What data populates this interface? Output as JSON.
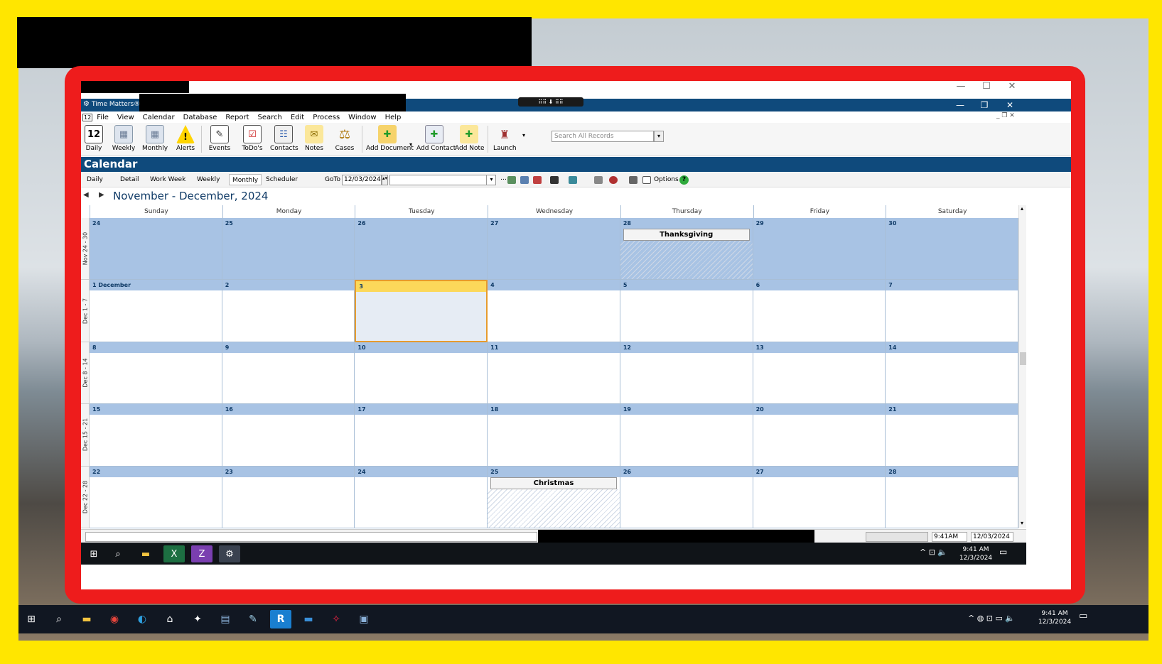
{
  "app": {
    "title": "Time Matters® -",
    "menus": [
      "File",
      "View",
      "Calendar",
      "Database",
      "Report",
      "Search",
      "Edit",
      "Process",
      "Window",
      "Help"
    ]
  },
  "toolbar": {
    "buttons": [
      {
        "label": "Daily",
        "icon": "calendar-day-icon",
        "glyph": "12"
      },
      {
        "label": "Weekly",
        "icon": "calendar-week-icon",
        "glyph": "▦"
      },
      {
        "label": "Monthly",
        "icon": "calendar-month-icon",
        "glyph": "▦"
      },
      {
        "label": "Alerts",
        "icon": "warning-icon",
        "glyph": "!"
      },
      {
        "label": "Events",
        "icon": "events-icon",
        "glyph": "✎"
      },
      {
        "label": "ToDo's",
        "icon": "todo-list-icon",
        "glyph": "☑"
      },
      {
        "label": "Contacts",
        "icon": "contacts-icon",
        "glyph": "☷"
      },
      {
        "label": "Notes",
        "icon": "notes-icon",
        "glyph": "✉"
      },
      {
        "label": "Cases",
        "icon": "scales-icon",
        "glyph": "⚖"
      },
      {
        "label": "Add Document",
        "icon": "add-document-icon",
        "glyph": "✚"
      },
      {
        "label": "Add Contact",
        "icon": "add-contact-icon",
        "glyph": "✚"
      },
      {
        "label": "Add Note",
        "icon": "add-note-icon",
        "glyph": "✚"
      },
      {
        "label": "Launch",
        "icon": "launch-bell-icon",
        "glyph": "♜"
      }
    ],
    "search_placeholder": "Search All Records"
  },
  "calendar": {
    "header": "Calendar",
    "views": [
      "Daily",
      "Detail",
      "Work Week",
      "Weekly",
      "Monthly",
      "Scheduler"
    ],
    "active_view": "Monthly",
    "goto_label": "GoTo",
    "goto_date": "12/03/2024",
    "options_label": "Options",
    "month_title": "November - December, 2024",
    "day_headers": [
      "Sunday",
      "Monday",
      "Tuesday",
      "Wednesday",
      "Thursday",
      "Friday",
      "Saturday"
    ],
    "weeks": [
      {
        "label": "Nov 24 - 30",
        "days": [
          "24",
          "25",
          "26",
          "27",
          "28",
          "29",
          "30"
        ],
        "shaded": true
      },
      {
        "label": "Dec 1 - 7",
        "days": [
          "1 December",
          "2",
          "3",
          "4",
          "5",
          "6",
          "7"
        ],
        "shaded": false
      },
      {
        "label": "Dec 8 - 14",
        "days": [
          "8",
          "9",
          "10",
          "11",
          "12",
          "13",
          "14"
        ],
        "shaded": false
      },
      {
        "label": "Dec 15 - 21",
        "days": [
          "15",
          "16",
          "17",
          "18",
          "19",
          "20",
          "21"
        ],
        "shaded": false
      },
      {
        "label": "Dec 22 - 28",
        "days": [
          "22",
          "23",
          "24",
          "25",
          "26",
          "27",
          "28"
        ],
        "shaded": false
      }
    ],
    "today": {
      "week": 1,
      "day": 2
    },
    "events": [
      {
        "week": 0,
        "day": 4,
        "title": "Thanksgiving"
      },
      {
        "week": 4,
        "day": 3,
        "title": "Christmas"
      }
    ]
  },
  "status": {
    "time": "9:41AM",
    "date": "12/03/2024"
  },
  "tray": {
    "time": "9:41 AM",
    "date": "12/3/2024"
  }
}
